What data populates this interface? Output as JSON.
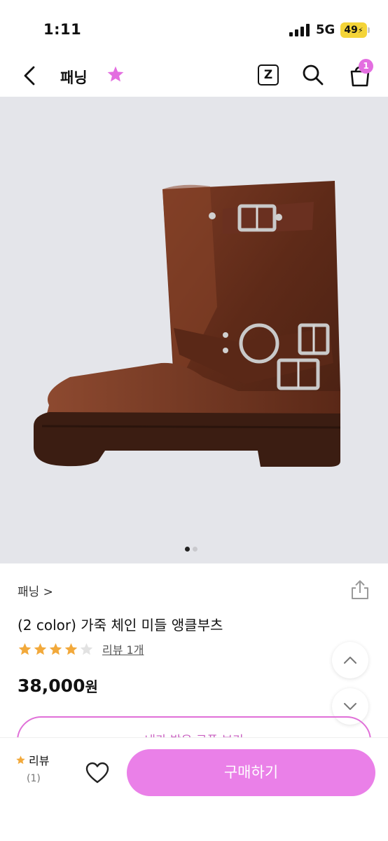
{
  "status_bar": {
    "time": "1:11",
    "network": "5G",
    "battery": "49"
  },
  "header": {
    "back_icon": "chevron-left-icon",
    "title": "패닝",
    "favorite_icon": "star-icon",
    "z_label": "Z",
    "cart_count": "1",
    "accent_color": "#e36ee0"
  },
  "gallery": {
    "image_count": 2,
    "active_index": 0
  },
  "product": {
    "brand": "패닝 >",
    "title": "(2 color) 가죽 체인 미들 앵클부츠",
    "rating": 4,
    "rating_max": 5,
    "review_link": "리뷰 1개",
    "price": "38,000",
    "price_unit": "원",
    "star_color": "#f2a93b"
  },
  "coupon": {
    "label": "내가 받은 쿠폰 보기"
  },
  "bottom_bar": {
    "review_label": "리뷰",
    "review_count": "(1)",
    "buy_label": "구매하기",
    "buy_color": "#ea80e8"
  }
}
